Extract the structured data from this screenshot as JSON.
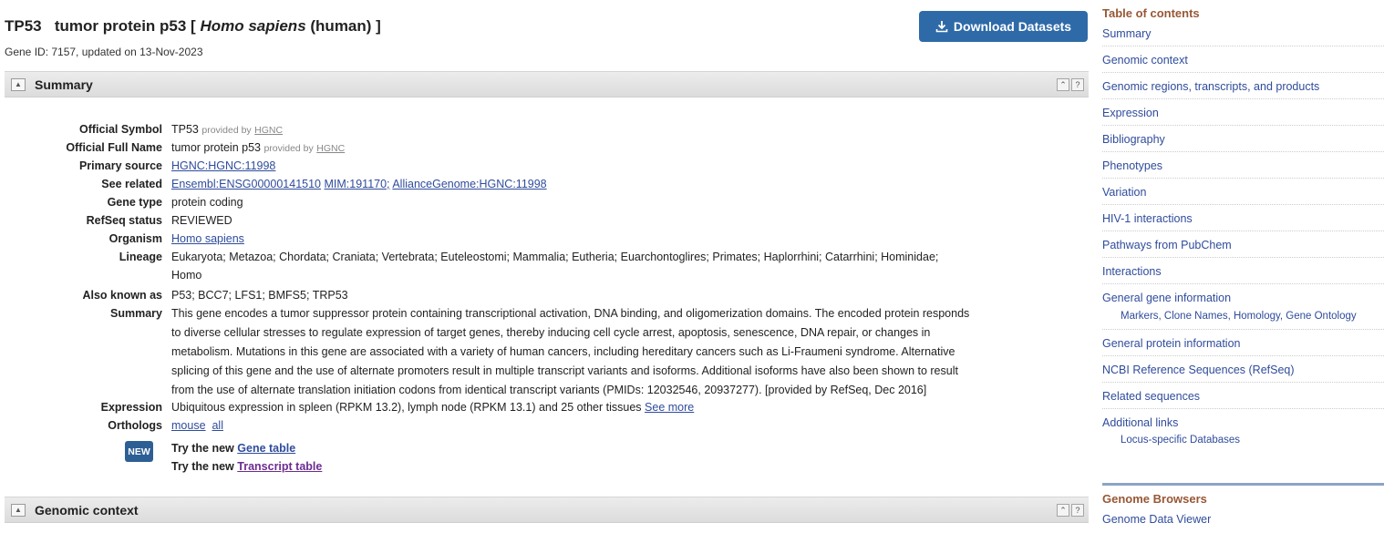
{
  "header": {
    "symbol": "TP53",
    "name": "tumor protein p53 [",
    "organism_italic": "Homo sapiens",
    "organism_tail": "(human) ]",
    "gene_meta": "Gene ID: 7157, updated on 13-Nov-2023",
    "download_label": "Download Datasets"
  },
  "sections": {
    "summary_title": "Summary",
    "genomic_title": "Genomic context",
    "collapse_icon": "collapse-arrow-icon",
    "help_label": "?"
  },
  "summary": {
    "official_symbol": {
      "label": "Official Symbol",
      "value": "TP53",
      "provided": "provided by",
      "link": "HGNC"
    },
    "official_full_name": {
      "label": "Official Full Name",
      "value": "tumor protein p53",
      "provided": "provided by",
      "link": "HGNC"
    },
    "primary_source": {
      "label": "Primary source",
      "link": "HGNC:HGNC:11998"
    },
    "see_related": {
      "label": "See related",
      "link1": "Ensembl:ENSG00000141510",
      "link2": "MIM:191170;",
      "link3": "AllianceGenome:HGNC:11998"
    },
    "gene_type": {
      "label": "Gene type",
      "value": "protein coding"
    },
    "refseq_status": {
      "label": "RefSeq status",
      "value": "REVIEWED"
    },
    "organism": {
      "label": "Organism",
      "link": "Homo sapiens"
    },
    "lineage": {
      "label": "Lineage",
      "value_line1": "Eukaryota; Metazoa; Chordata; Craniata; Vertebrata; Euteleostomi; Mammalia; Eutheria; Euarchontoglires; Primates; Haplorrhini; Catarrhini; Hominidae;",
      "value_line2": "Homo"
    },
    "also_known_as": {
      "label": "Also known as",
      "value": "P53; BCC7; LFS1; BMFS5; TRP53"
    },
    "summary_text": {
      "label": "Summary",
      "line1": "This gene encodes a tumor suppressor protein containing transcriptional activation, DNA binding, and oligomerization domains. The encoded protein responds",
      "line2": "to diverse cellular stresses to regulate expression of target genes, thereby inducing cell cycle arrest, apoptosis, senescence, DNA repair, or changes in",
      "line3": "metabolism. Mutations in this gene are associated with a variety of human cancers, including hereditary cancers such as Li-Fraumeni syndrome. Alternative",
      "line4": "splicing of this gene and the use of alternate promoters result in multiple transcript variants and isoforms. Additional isoforms have also been shown to result",
      "line5": "from the use of alternate translation initiation codons from identical transcript variants (PMIDs: 12032546, 20937277). [provided by RefSeq, Dec 2016]"
    },
    "expression": {
      "label": "Expression",
      "value": "Ubiquitous expression in spleen (RPKM 13.2), lymph node (RPKM 13.1) and 25 other tissues",
      "link": "See more"
    },
    "orthologs": {
      "label": "Orthologs",
      "link1": "mouse",
      "link2": "all"
    },
    "new_badge": "NEW",
    "try_gene_prefix": "Try the new",
    "try_gene_link": "Gene table",
    "try_transcript_prefix": "Try the new",
    "try_transcript_link": "Transcript table"
  },
  "toc": {
    "heading": "Table of contents",
    "items": [
      "Summary",
      "Genomic context",
      "Genomic regions, transcripts, and products",
      "Expression",
      "Bibliography",
      "Phenotypes",
      "Variation",
      "HIV-1 interactions",
      "Pathways from PubChem",
      "Interactions",
      "General gene information",
      "General protein information",
      "NCBI Reference Sequences (RefSeq)",
      "Related sequences",
      "Additional links"
    ],
    "general_gene_sub": "Markers, Clone Names, Homology, Gene Ontology",
    "additional_links_sub": "Locus-specific Databases",
    "genome_browsers_heading": "Genome Browsers",
    "genome_data_viewer": "Genome Data Viewer"
  },
  "colors": {
    "accent": "#2e6aa8",
    "link": "#2f4c9c",
    "toc_heading": "#985735",
    "visited_link": "#6a2c91"
  }
}
